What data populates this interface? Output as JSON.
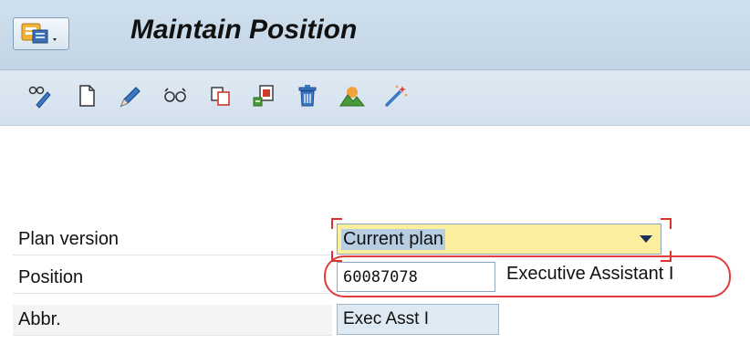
{
  "header": {
    "title": "Maintain Position"
  },
  "toolbar": {
    "icons": [
      "display-maintain-icon",
      "create-icon",
      "change-icon",
      "display-icon",
      "copy-icon",
      "delimit-icon",
      "delete-icon",
      "overview-icon",
      "wizard-icon"
    ]
  },
  "form": {
    "plan_version": {
      "label": "Plan version",
      "value": "Current plan"
    },
    "position": {
      "label": "Position",
      "value": "60087078",
      "description": "Executive Assistant I"
    },
    "abbr": {
      "label": "Abbr.",
      "value": "Exec Asst I"
    }
  },
  "colors": {
    "required_field_bg": "#fbee9c",
    "highlight": "#e23b3b",
    "header_bg": "#c3d6e6"
  }
}
